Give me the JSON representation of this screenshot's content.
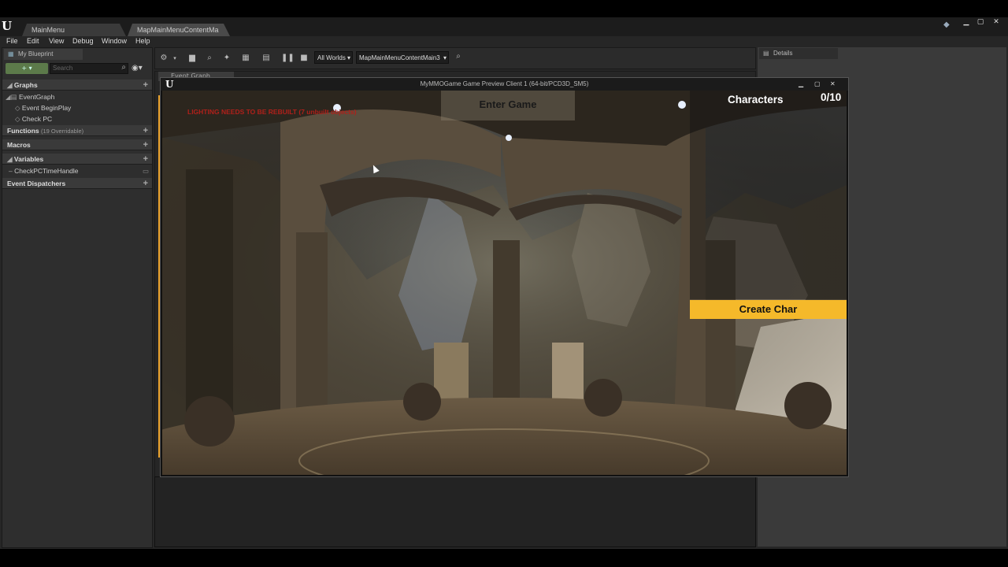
{
  "tabs": [
    {
      "label": "MainMenu"
    },
    {
      "label": "MapMainMenuContentMa"
    }
  ],
  "menu": [
    "File",
    "Edit",
    "View",
    "Debug",
    "Window",
    "Help"
  ],
  "left_panel": {
    "tab_label": "My Blueprint",
    "search_placeholder": "Search",
    "graphs": {
      "label": "Graphs",
      "items": [
        "EventGraph",
        "Event BeginPlay",
        "Check PC"
      ]
    },
    "functions": {
      "label": "Functions",
      "note": "(19 Overridable)"
    },
    "macros": {
      "label": "Macros"
    },
    "variables": {
      "label": "Variables",
      "items": [
        "CheckPCTimeHandle"
      ]
    },
    "dispatchers": {
      "label": "Event Dispatchers"
    }
  },
  "toolbar": {
    "world_select": "All Worlds",
    "object_select": "MapMainMenuContentMain3"
  },
  "graph_tab": "Event Graph",
  "details_tab": "Details",
  "game_window": {
    "title": "MyMMOGame Game Preview Client 1 (64-bit/PCD3D_SM5)",
    "warning": "LIGHTING NEEDS TO BE REBUILT (7 unbuilt objects)",
    "enter_game": "Enter Game",
    "characters_label": "Characters",
    "characters_count": "0/10",
    "create_char": "Create Char"
  },
  "colors": {
    "accent_yellow": "#f5b92a",
    "warning_red": "#b0201a"
  }
}
